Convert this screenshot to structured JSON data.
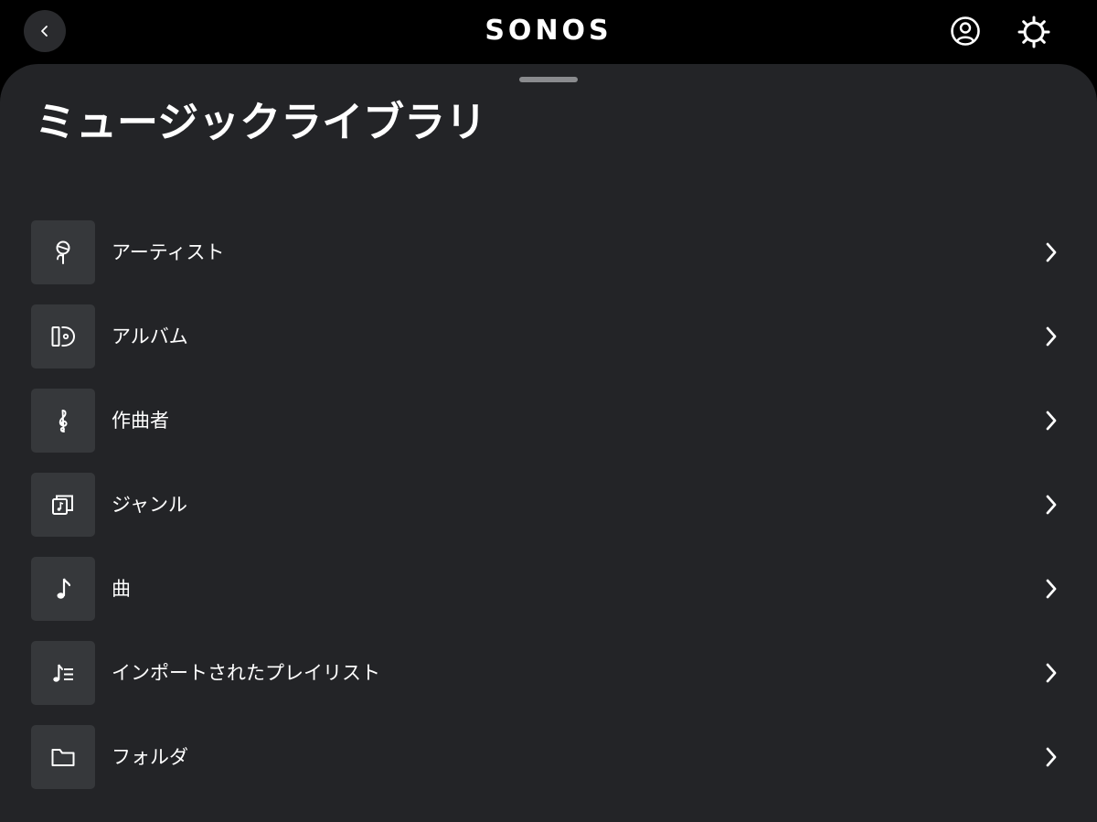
{
  "header": {
    "logo_text": "SONOS",
    "back_icon": "chevron-left-icon",
    "account_icon": "user-circle-icon",
    "settings_icon": "gear-icon"
  },
  "sheet": {
    "title": "ミュージックライブラリ"
  },
  "menu": {
    "items": [
      {
        "label": "アーティスト",
        "icon": "microphone-icon"
      },
      {
        "label": "アルバム",
        "icon": "album-icon"
      },
      {
        "label": "作曲者",
        "icon": "treble-clef-icon"
      },
      {
        "label": "ジャンル",
        "icon": "genre-icon"
      },
      {
        "label": "曲",
        "icon": "music-note-icon"
      },
      {
        "label": "インポートされたプレイリスト",
        "icon": "playlist-icon"
      },
      {
        "label": "フォルダ",
        "icon": "folder-icon"
      }
    ]
  },
  "colors": {
    "background": "#000000",
    "sheet": "#232427",
    "tile": "#36383b",
    "text": "#ffffff"
  }
}
